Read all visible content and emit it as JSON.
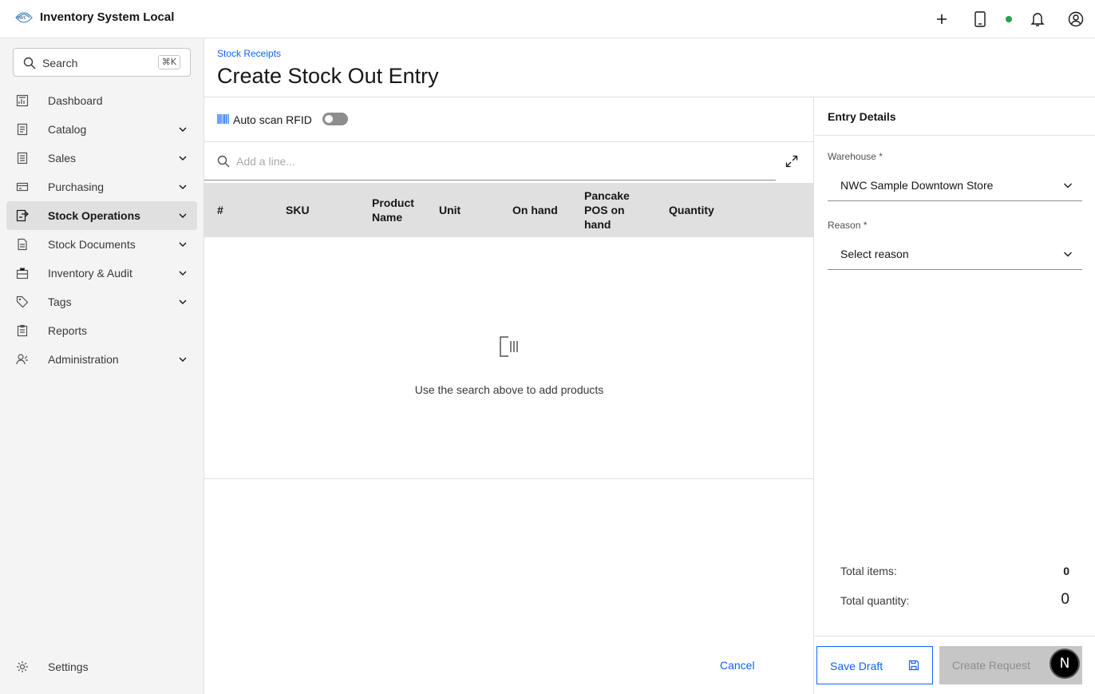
{
  "header": {
    "app_title": "Inventory System Local",
    "status_color": "#24a148"
  },
  "sidebar": {
    "search_label": "Search",
    "search_shortcut": "⌘K",
    "items": [
      {
        "label": "Dashboard",
        "icon": "dashboard-icon",
        "expandable": false
      },
      {
        "label": "Catalog",
        "icon": "catalog-icon",
        "expandable": true
      },
      {
        "label": "Sales",
        "icon": "sales-icon",
        "expandable": true
      },
      {
        "label": "Purchasing",
        "icon": "purchasing-icon",
        "expandable": true
      },
      {
        "label": "Stock Operations",
        "icon": "stock-operations-icon",
        "expandable": true,
        "active": true
      },
      {
        "label": "Stock Documents",
        "icon": "document-icon",
        "expandable": true
      },
      {
        "label": "Inventory & Audit",
        "icon": "inventory-icon",
        "expandable": true
      },
      {
        "label": "Tags",
        "icon": "tag-icon",
        "expandable": true
      },
      {
        "label": "Reports",
        "icon": "report-icon",
        "expandable": false
      },
      {
        "label": "Administration",
        "icon": "user-admin-icon",
        "expandable": true
      }
    ],
    "settings_label": "Settings"
  },
  "page": {
    "breadcrumb": "Stock Receipts",
    "title": "Create Stock Out Entry"
  },
  "main": {
    "rfid_label": "Auto scan RFID",
    "line_search_placeholder": "Add a line...",
    "columns": [
      "#",
      "SKU",
      "Product Name",
      "Unit",
      "On hand",
      "Pancake POS on hand",
      "Quantity"
    ],
    "empty_message": "Use the search above to add products",
    "cancel_label": "Cancel"
  },
  "details": {
    "title": "Entry Details",
    "warehouse_label": "Warehouse *",
    "warehouse_value": "NWC Sample Downtown Store",
    "reason_label": "Reason *",
    "reason_value": "Select reason",
    "total_items_label": "Total items:",
    "total_items_value": "0",
    "total_quantity_label": "Total quantity:",
    "total_quantity_value": "0",
    "save_draft_label": "Save Draft",
    "create_request_label": "Create Request"
  },
  "fab_label": "N"
}
